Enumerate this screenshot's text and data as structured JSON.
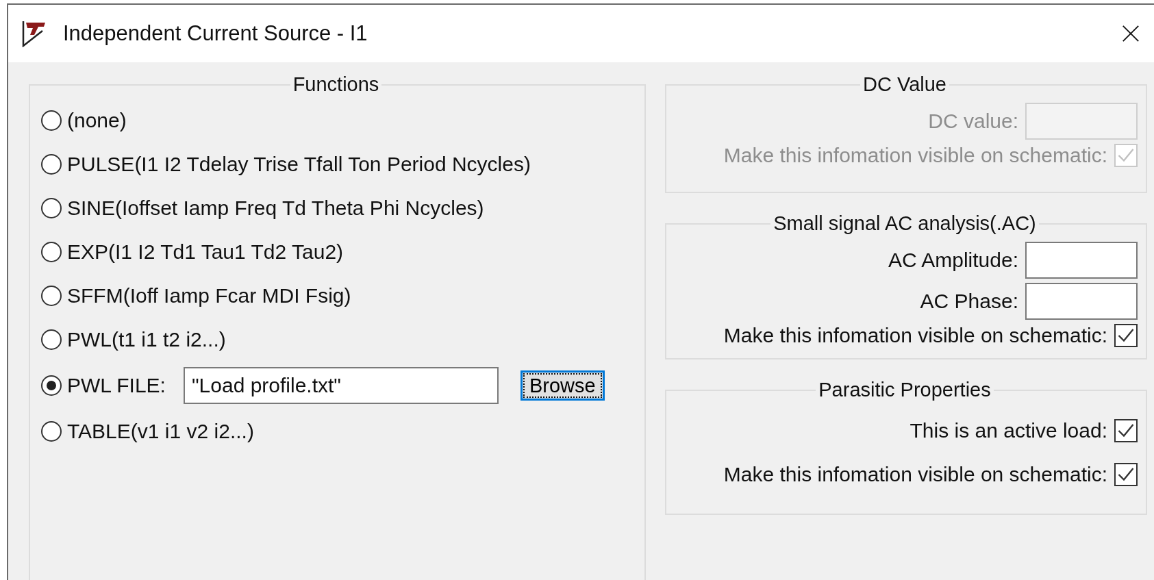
{
  "window": {
    "title": "Independent Current Source - I1"
  },
  "functions": {
    "title": "Functions",
    "options": [
      {
        "kind": "plain",
        "label": "(none)",
        "selected": false
      },
      {
        "kind": "plain",
        "label": "PULSE(I1 I2 Tdelay Trise Tfall Ton Period Ncycles)",
        "selected": false
      },
      {
        "kind": "plain",
        "label": "SINE(Ioffset Iamp Freq Td Theta Phi Ncycles)",
        "selected": false
      },
      {
        "kind": "plain",
        "label": "EXP(I1 I2 Td1 Tau1 Td2 Tau2)",
        "selected": false
      },
      {
        "kind": "plain",
        "label": "SFFM(Ioff Iamp Fcar MDI Fsig)",
        "selected": false
      },
      {
        "kind": "plain",
        "label": "PWL(t1 i1 t2 i2...)",
        "selected": false
      },
      {
        "kind": "file",
        "label": "PWL FILE:",
        "selected": true,
        "value": "\"Load profile.txt\"",
        "button": "Browse"
      },
      {
        "kind": "plain",
        "label": "TABLE(v1 i1 v2 i2...)",
        "selected": false
      }
    ]
  },
  "dc_value": {
    "title": "DC Value",
    "disabled": true,
    "fields": [
      {
        "label": "DC value:"
      }
    ],
    "visible_label": "Make this infomation visible on schematic:",
    "visible_checked": true
  },
  "ac_analysis": {
    "title": "Small signal AC analysis(.AC)",
    "disabled": false,
    "fields": [
      {
        "label": "AC Amplitude:"
      },
      {
        "label": "AC Phase:"
      }
    ],
    "visible_label": "Make this infomation visible on schematic:",
    "visible_checked": true
  },
  "parasitic": {
    "title": "Parasitic Properties",
    "checks": [
      {
        "label": "This is an active load:",
        "checked": true
      },
      {
        "label": "Make this infomation visible on schematic:",
        "checked": true
      }
    ]
  }
}
